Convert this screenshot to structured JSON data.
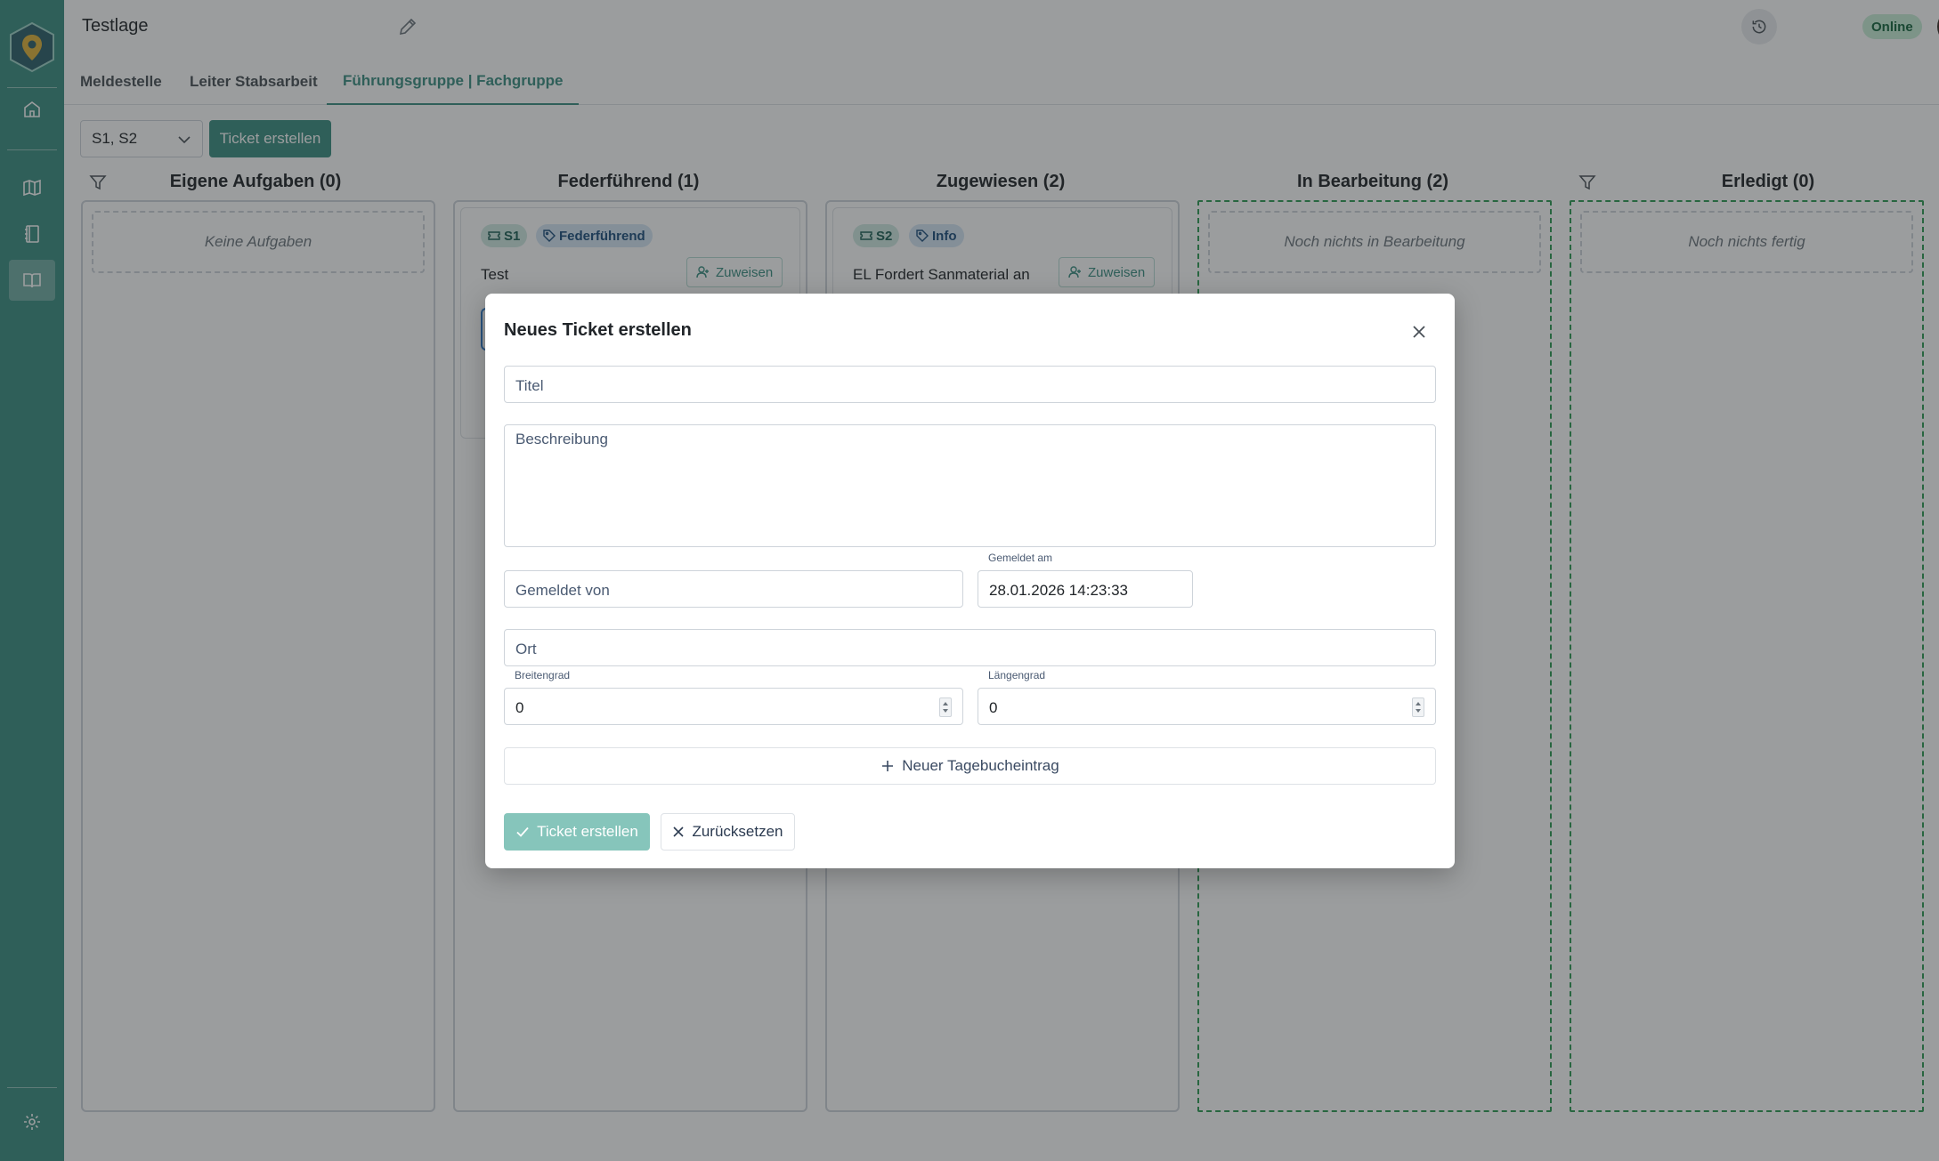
{
  "header": {
    "title": "Testlage",
    "status": "Online"
  },
  "tabs": [
    {
      "label": "Meldestelle"
    },
    {
      "label": "Leiter Stabsarbeit"
    },
    {
      "label": "Führungsgruppe | Fachgruppe",
      "active": true
    }
  ],
  "toolbar": {
    "section_select_value": "S1, S2",
    "create_ticket_label": "Ticket erstellen"
  },
  "columns": [
    {
      "title": "Eigene Aufgaben (0)",
      "empty_text": "Keine Aufgaben"
    },
    {
      "title": "Federführend (1)",
      "cards": [
        {
          "section": "S1",
          "tag": "Federführend",
          "title": "Test",
          "assign_label": "Zuweisen"
        }
      ]
    },
    {
      "title": "Zugewiesen (2)",
      "cards": [
        {
          "section": "S2",
          "tag": "Info",
          "title": "EL Fordert Sanmaterial an",
          "assign_label": "Zuweisen"
        }
      ]
    },
    {
      "title": "In Bearbeitung (2)",
      "empty_text": "Noch nichts in Bearbeitung"
    },
    {
      "title": "Erledigt (0)",
      "empty_text": "Noch nichts fertig"
    }
  ],
  "modal": {
    "title": "Neues Ticket erstellen",
    "fields": {
      "title_placeholder": "Titel",
      "description_placeholder": "Beschreibung",
      "reported_by_placeholder": "Gemeldet von",
      "reported_at_label": "Gemeldet am",
      "reported_at_value": "28.01.2026 14:23:33",
      "location_placeholder": "Ort",
      "latitude_label": "Breitengrad",
      "latitude_value": "0",
      "longitude_label": "Längengrad",
      "longitude_value": "0"
    },
    "diary_button": "Neuer Tagebucheintrag",
    "submit_button": "Ticket erstellen",
    "reset_button": "Zurücksetzen"
  },
  "colors": {
    "primary": "#3b8e82",
    "done_border": "#2f9b55",
    "online_bg": "#c8eed8"
  }
}
